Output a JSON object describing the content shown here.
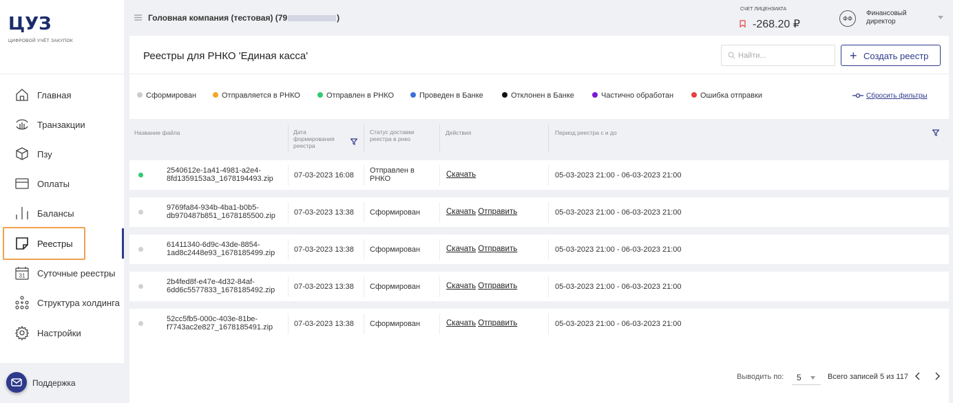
{
  "sidebar": {
    "logo": "ЦУЗ",
    "logo_subtitle": "цифровой учёт закупок",
    "items": [
      {
        "label": "Главная",
        "icon": "home-icon"
      },
      {
        "label": "Транзакции",
        "icon": "transactions-icon"
      },
      {
        "label": "Пзу",
        "icon": "box-icon"
      },
      {
        "label": "Оплаты",
        "icon": "card-icon"
      },
      {
        "label": "Балансы",
        "icon": "bars-icon"
      },
      {
        "label": "Реестры",
        "icon": "note-icon",
        "active": true
      },
      {
        "label": "Суточные реестры",
        "icon": "calendar-icon",
        "day": "31"
      },
      {
        "label": "Структура холдинга",
        "icon": "hierarchy-icon"
      },
      {
        "label": "Настройки",
        "icon": "gear-icon"
      }
    ],
    "support_label": "Поддержка"
  },
  "topbar": {
    "company_prefix": "Головная компания (тестовая) (79",
    "company_suffix": ")",
    "account_label": "Счет лицензиата",
    "account_value": "-268.20 ₽",
    "avatar_initials": "ФФ",
    "role": "Финансовый директор"
  },
  "page": {
    "title": "Реестры для РНКО 'Единая касса'",
    "search_placeholder": "Найти...",
    "create_button": "Создать реестр"
  },
  "legend": [
    {
      "label": "Сформирован",
      "color": "#cccccc"
    },
    {
      "label": "Отправляется в РНКО",
      "color": "#f5a623"
    },
    {
      "label": "Отправлен в РНКО",
      "color": "#2ecc71"
    },
    {
      "label": "Проведен в Банке",
      "color": "#3b6fd8"
    },
    {
      "label": "Отклонен в Банке",
      "color": "#111111"
    },
    {
      "label": "Частично обработан",
      "color": "#7b16d8"
    },
    {
      "label": "Ошибка отправки",
      "color": "#e84040"
    }
  ],
  "reset_filters": "Сбросить фильтры",
  "table": {
    "headers": {
      "file": "Название файла",
      "date": "Дата формирования реестра",
      "status": "Статус доставки реестра в рнко",
      "actions": "Действия",
      "period": "Период реестра с и до"
    },
    "rows": [
      {
        "file": "2540612e-1a41-4981-a2e4-8fd1359153a3_1678194493.zip",
        "date": "07-03-2023 16:08",
        "status": "Отправлен в РНКО",
        "dot": "#2ecc71",
        "actions": [
          "Скачать"
        ],
        "period": "05-03-2023 21:00 - 06-03-2023 21:00"
      },
      {
        "file": "9769fa84-934b-4ba1-b0b5-db970487b851_1678185500.zip",
        "date": "07-03-2023 13:38",
        "status": "Сформирован",
        "dot": "#d0d0d0",
        "actions": [
          "Скачать",
          "Отправить"
        ],
        "period": "05-03-2023 21:00 - 06-03-2023 21:00"
      },
      {
        "file": "61411340-6d9c-43de-8854-1ad8c2448e93_1678185499.zip",
        "date": "07-03-2023 13:38",
        "status": "Сформирован",
        "dot": "#d0d0d0",
        "actions": [
          "Скачать",
          "Отправить"
        ],
        "period": "05-03-2023 21:00 - 06-03-2023 21:00"
      },
      {
        "file": "2b4fed8f-e47e-4d32-84af-6dd6c5577833_1678185492.zip",
        "date": "07-03-2023 13:38",
        "status": "Сформирован",
        "dot": "#d0d0d0",
        "actions": [
          "Скачать",
          "Отправить"
        ],
        "period": "05-03-2023 21:00 - 06-03-2023 21:00"
      },
      {
        "file": "52cc5fb5-000c-403e-81be-f7743ac2e827_1678185491.zip",
        "date": "07-03-2023 13:38",
        "status": "Сформирован",
        "dot": "#d0d0d0",
        "actions": [
          "Скачать",
          "Отправить"
        ],
        "period": "05-03-2023 21:00 - 06-03-2023 21:00"
      }
    ]
  },
  "pagination": {
    "label": "Выводить по:",
    "page_size": "5",
    "total": "Всего записей 5 из 117"
  },
  "colors": {
    "brand": "#2d3a8c",
    "highlight": "#f0a050",
    "negative_icon": "#e84040"
  }
}
